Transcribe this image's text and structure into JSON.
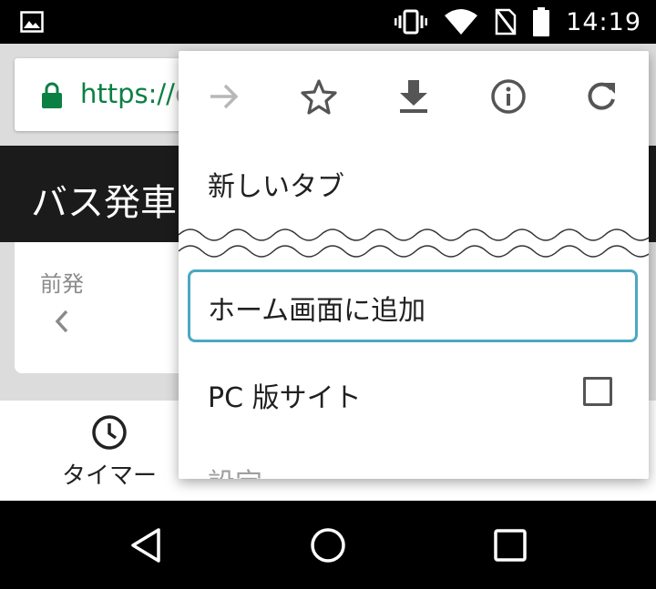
{
  "status_bar": {
    "time": "14:19",
    "icons": [
      "gallery-icon",
      "vibrate-icon",
      "wifi-icon",
      "no-sim-icon",
      "battery-icon"
    ]
  },
  "browser": {
    "url_scheme": "https://",
    "url_rest": "c"
  },
  "page": {
    "header_title": "バス発車",
    "card_label": "前発",
    "timer_tab_label": "タイマー"
  },
  "menu": {
    "actions": [
      "forward-icon",
      "bookmark-star-icon",
      "download-icon",
      "info-icon",
      "reload-icon"
    ],
    "new_tab": "新しいタブ",
    "add_to_home": "ホーム画面に追加",
    "desktop_site": "PC 版サイト",
    "desktop_site_checked": false,
    "settings": "設定"
  },
  "nav_bar": {
    "buttons": [
      "back-icon",
      "home-icon",
      "recents-icon"
    ]
  },
  "colors": {
    "lock_green": "#0b8043",
    "highlight": "#4ba8c2",
    "header_band": "#1b1b1b"
  }
}
